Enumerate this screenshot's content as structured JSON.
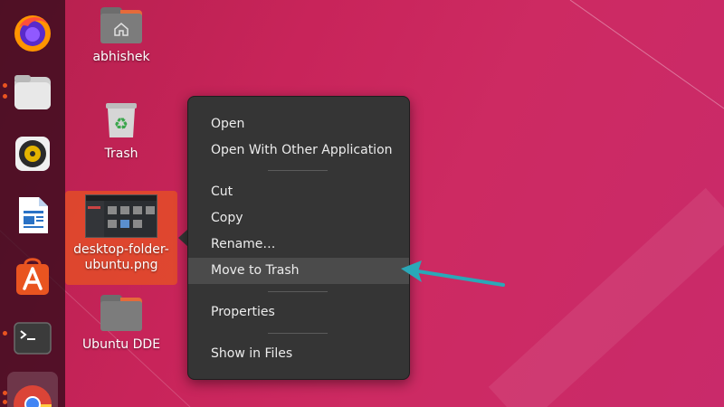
{
  "dock": {
    "items": [
      {
        "name": "firefox",
        "icon": "firefox-icon"
      },
      {
        "name": "files",
        "icon": "files-icon"
      },
      {
        "name": "rhythmbox",
        "icon": "rhythmbox-icon"
      },
      {
        "name": "writer",
        "icon": "libreoffice-writer-icon"
      },
      {
        "name": "software",
        "icon": "ubuntu-software-icon"
      },
      {
        "name": "terminal",
        "icon": "terminal-icon"
      },
      {
        "name": "chrome",
        "icon": "chrome-icon"
      }
    ]
  },
  "desktop": {
    "home_label": "abhishek",
    "trash_label": "Trash",
    "selected_label_line1": "desktop-folder-",
    "selected_label_line2": "ubuntu.png",
    "folder_label": "Ubuntu DDE"
  },
  "context_menu": {
    "open": "Open",
    "open_with": "Open With Other Application",
    "cut": "Cut",
    "copy": "Copy",
    "rename": "Rename…",
    "move_to_trash": "Move to Trash",
    "properties": "Properties",
    "show_in_files": "Show in Files"
  },
  "colors": {
    "accent": "#e95420",
    "annotation_arrow": "#2aa8b8",
    "menu_bg": "#353535"
  }
}
